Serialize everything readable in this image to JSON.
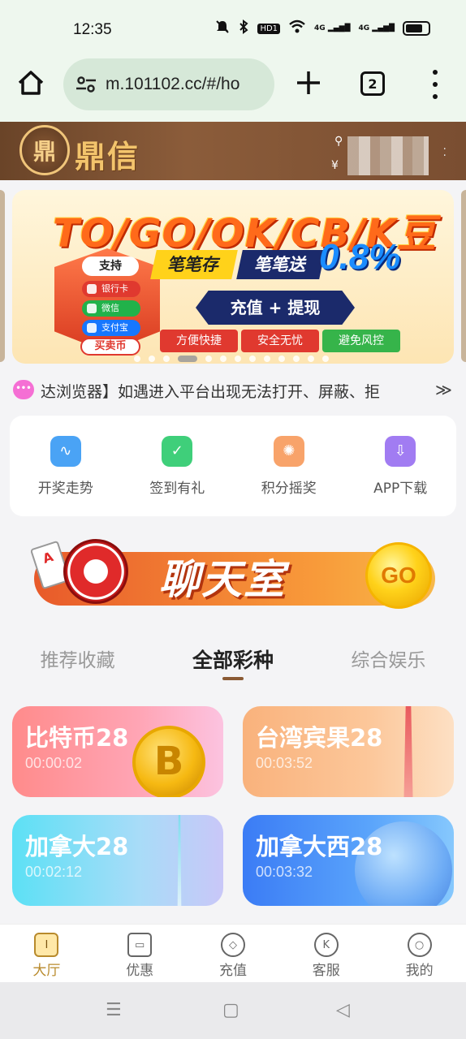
{
  "status_bar": {
    "time": "12:35",
    "icons": [
      "mute-icon",
      "bluetooth-icon",
      "hd-icon",
      "wifi-icon",
      "signal-4g-icon",
      "signal-4g-icon",
      "battery-icon"
    ],
    "hd_label": "HD1",
    "net1": "4G",
    "net2": "4G"
  },
  "browser": {
    "url": "m.101102.cc/#/ho",
    "tab_count": "2"
  },
  "site": {
    "logo_glyph": "鼎",
    "name": "鼎信",
    "currency_symbol": "¥",
    "brand_color": "#8b5c3a"
  },
  "banner": {
    "title": "TO/GO/OK/CB/K豆",
    "support_label": "支持",
    "payments": [
      "银行卡",
      "微信",
      "支付宝"
    ],
    "buy_sell": "买卖币",
    "tag1": "笔笔存",
    "tag2": "笔笔送",
    "rate": "0.8%",
    "recharge": "充值 + 提现",
    "features": [
      "方便快捷",
      "安全无忧",
      "避免风控"
    ],
    "slide_count": 13,
    "active_slide": 3
  },
  "marquee": {
    "icon_label": "•••",
    "text": "达浏览器】如遇进入平台出现无法打开、屏蔽、拒",
    "more_glyph": "≫"
  },
  "quick_menu": {
    "items": [
      {
        "label": "开奖走势",
        "icon": "trend-chart-icon",
        "color": "#4aa3f5"
      },
      {
        "label": "签到有礼",
        "icon": "calendar-check-icon",
        "color": "#3fcf7a"
      },
      {
        "label": "积分摇奖",
        "icon": "wheel-icon",
        "color": "#f8a36a"
      },
      {
        "label": "APP下载",
        "icon": "download-cloud-icon",
        "color": "#a17cf2"
      }
    ]
  },
  "chat_banner": {
    "title": "聊天室",
    "go_label": "GO",
    "card_glyph": "A"
  },
  "tabs": {
    "items": [
      "推荐收藏",
      "全部彩种",
      "综合娱乐"
    ],
    "active": 1
  },
  "games": [
    {
      "name": "比特币28",
      "time": "00:00:02",
      "coin_glyph": "B"
    },
    {
      "name": "台湾宾果28",
      "time": "00:03:52"
    },
    {
      "name": "加拿大28",
      "time": "00:02:12"
    },
    {
      "name": "加拿大西28",
      "time": "00:03:32"
    }
  ],
  "bottom_nav": {
    "items": [
      {
        "label": "大厅",
        "icon": "lobby-icon",
        "glyph": "I"
      },
      {
        "label": "优惠",
        "icon": "ticket-icon",
        "glyph": "▭"
      },
      {
        "label": "充值",
        "icon": "recharge-icon",
        "glyph": "◇"
      },
      {
        "label": "客服",
        "icon": "support-icon",
        "glyph": "K"
      },
      {
        "label": "我的",
        "icon": "profile-icon",
        "glyph": "○"
      }
    ],
    "active": 0,
    "active_color": "#b88a2c"
  }
}
